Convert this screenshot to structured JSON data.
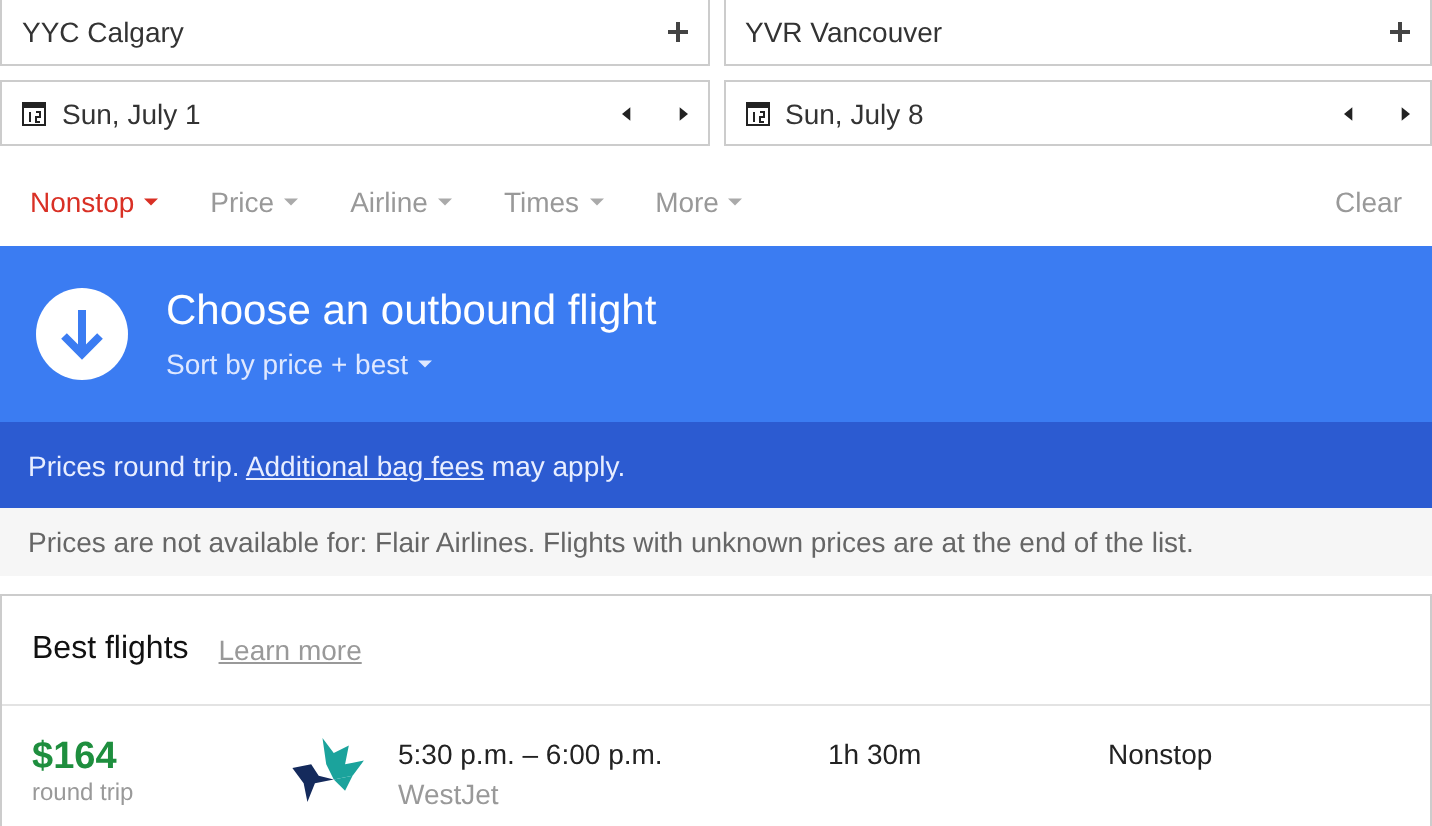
{
  "places": [
    {
      "value": "YYC Calgary"
    },
    {
      "value": "YVR Vancouver"
    }
  ],
  "dates": [
    {
      "value": "Sun, July 1"
    },
    {
      "value": "Sun, July 8"
    }
  ],
  "filters": [
    {
      "label": "Nonstop",
      "selected": true
    },
    {
      "label": "Price",
      "selected": false
    },
    {
      "label": "Airline",
      "selected": false
    },
    {
      "label": "Times",
      "selected": false
    },
    {
      "label": "More",
      "selected": false
    }
  ],
  "clear": "Clear",
  "banner": {
    "title": "Choose an outbound flight",
    "sort": "Sort by price + best"
  },
  "notice": {
    "before": "Prices round trip.",
    "link": "Additional bag fees",
    "after": "may apply."
  },
  "availability": "Prices are not available for: Flair Airlines. Flights with unknown prices are at the end of the list.",
  "best": {
    "title": "Best flights",
    "link": "Learn more"
  },
  "flights": [
    {
      "price": "$164",
      "price_note": "round trip",
      "times": "5:30 p.m. – 6:00 p.m.",
      "airline": "WestJet",
      "duration": "1h 30m",
      "stops": "Nonstop"
    }
  ]
}
